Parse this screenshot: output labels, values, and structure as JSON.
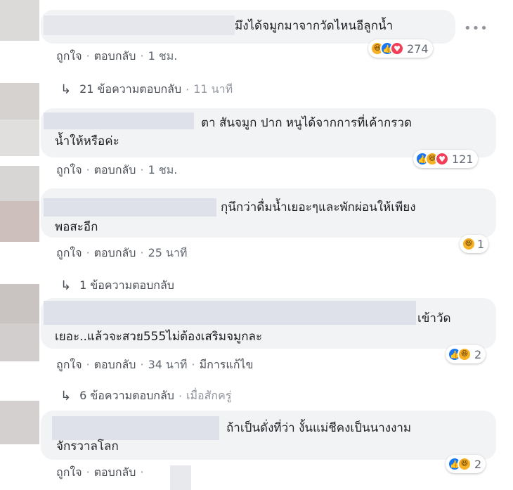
{
  "comments": [
    {
      "text_lines": [
        "มึงได้จมูกมาจากวัดไหนอีลูกน้ำ"
      ],
      "actions": {
        "like": "ถูกใจ",
        "reply": "ตอบกลับ",
        "time": "1 ชม."
      },
      "reactions": {
        "count": "274",
        "icons": [
          "haha-icon",
          "like-icon",
          "love-icon"
        ]
      },
      "replies": {
        "label": "21 ข้อความตอบกลับ",
        "time": "11 นาที"
      }
    },
    {
      "text_lines": [
        "ตา สันจมูก ปาก หนูได้จากการที่เค้ากรวด",
        "น้ำให้หรือค่ะ"
      ],
      "actions": {
        "like": "ถูกใจ",
        "reply": "ตอบกลับ",
        "time": "1 ชม."
      },
      "reactions": {
        "count": "121",
        "icons": [
          "like-icon",
          "haha-icon",
          "love-icon"
        ]
      }
    },
    {
      "text_lines": [
        "กุนึกว่าดื่มน้ำเยอะๆและพักผ่อนให้เพียง",
        "พอสะอีก"
      ],
      "actions": {
        "like": "ถูกใจ",
        "reply": "ตอบกลับ",
        "time": "25 นาที"
      },
      "reactions": {
        "count": "1",
        "icons": [
          "haha-icon"
        ]
      },
      "replies": {
        "label": "1 ข้อความตอบกลับ"
      }
    },
    {
      "text_lines": [
        "เข้าวัด",
        "เยอะ..แล้วจะสวย555ไม่ต้องเสริมจมูกละ"
      ],
      "actions": {
        "like": "ถูกใจ",
        "reply": "ตอบกลับ",
        "time": "34 นาที",
        "edited": "มีการแก้ไข"
      },
      "reactions": {
        "count": "2",
        "icons": [
          "like-icon",
          "haha-icon"
        ]
      },
      "replies": {
        "label": "6 ข้อความตอบกลับ",
        "time": "เมื่อสักครู่"
      }
    },
    {
      "text_lines": [
        "ถ้าเป็นดั่งที่ว่า งั้นแม่ชีคงเป็นนางงาม",
        "จักรวาลโลก"
      ],
      "actions": {
        "like": "ถูกใจ",
        "reply": "ตอบกลับ"
      },
      "reactions": {
        "count": "2",
        "icons": [
          "like-icon",
          "haha-icon"
        ]
      }
    }
  ],
  "more_icon": "more-options-icon",
  "reply_arrow_icon": "reply-arrow-icon"
}
